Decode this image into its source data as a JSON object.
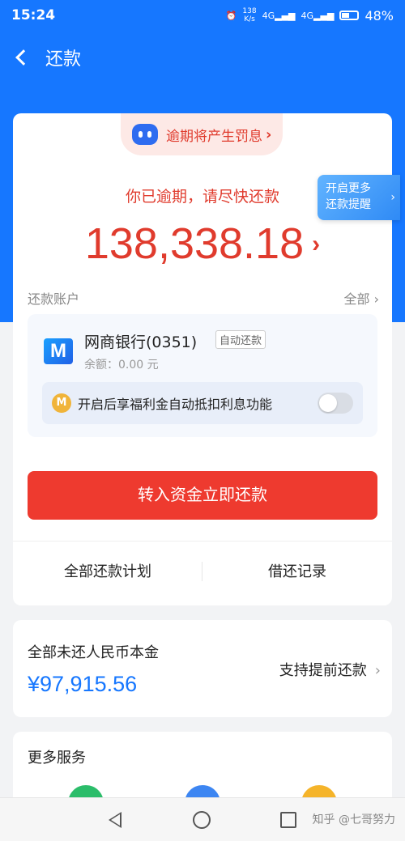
{
  "status_bar": {
    "time": "15:24",
    "net_speed_top": "138",
    "net_speed_bottom": "K/s",
    "net1": "4G",
    "net2": "4G",
    "battery": "48%"
  },
  "header": {
    "title": "还款"
  },
  "overdue_pill": {
    "text": "逾期将产生罚息",
    "chevron": "›"
  },
  "tip_badge": {
    "line1": "开启更多",
    "line2": "还款提醒",
    "chevron": "›"
  },
  "overdue": {
    "message": "你已逾期，请尽快还款",
    "amount": "138,338.18",
    "arrow": "›"
  },
  "account": {
    "label": "还款账户",
    "all": "全部 ›",
    "bank_logo": "M",
    "bank_name": "网商银行(0351)",
    "auto_tag": "自动还款",
    "balance": "余额：0.00 元",
    "feature_icon": "M",
    "feature_text": "开启后享福利金自动抵扣利息功能"
  },
  "pay_button": {
    "label": "转入资金立即还款"
  },
  "links": {
    "plan": "全部还款计划",
    "record": "借还记录"
  },
  "principal": {
    "label": "全部未还人民币本金",
    "amount": "¥97,915.56",
    "prepay": "支持提前还款",
    "chevron": "›"
  },
  "more_services": {
    "title": "更多服务"
  },
  "watermark": "知乎 @七哥努力",
  "colors": {
    "primary": "#1677ff",
    "danger": "#ee3a2f",
    "overdue_text": "#e03b2d"
  }
}
